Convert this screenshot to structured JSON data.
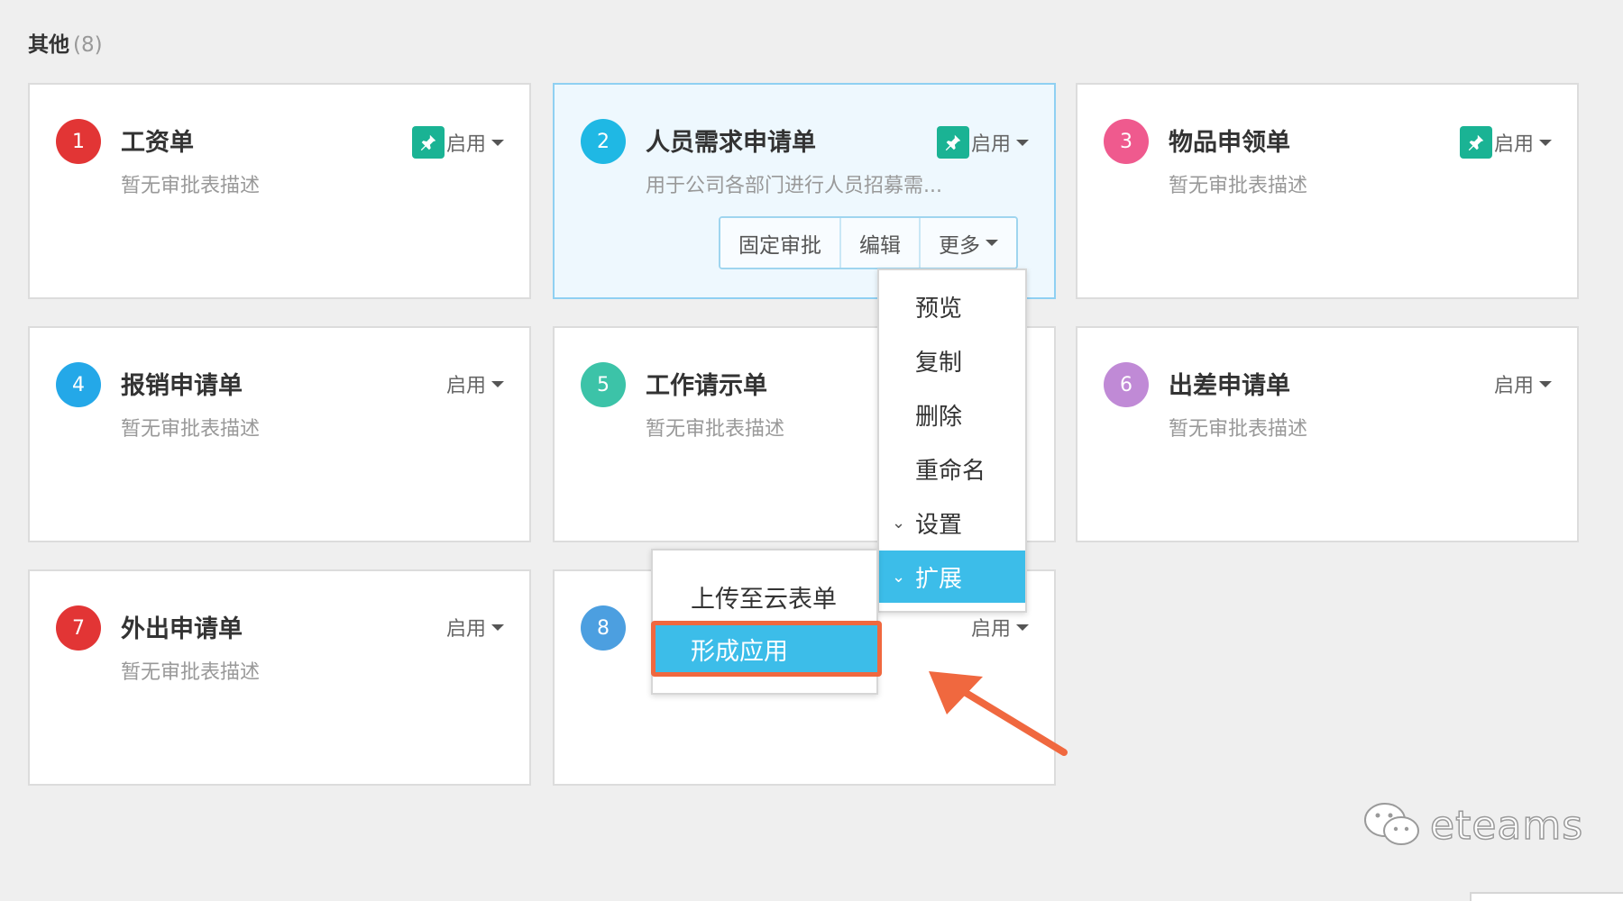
{
  "section": {
    "title": "其他",
    "count": "(8)"
  },
  "cards": [
    {
      "number": "1",
      "title": "工资单",
      "desc": "暂无审批表描述",
      "status": "启用",
      "pinned": true,
      "color": "#e23535"
    },
    {
      "number": "2",
      "title": "人员需求申请单",
      "desc": "用于公司各部门进行人员招募需...",
      "status": "启用",
      "pinned": true,
      "color": "#1fb8e4"
    },
    {
      "number": "3",
      "title": "物品申领单",
      "desc": "暂无审批表描述",
      "status": "启用",
      "pinned": true,
      "color": "#ef5a8e"
    },
    {
      "number": "4",
      "title": "报销申请单",
      "desc": "暂无审批表描述",
      "status": "启用",
      "pinned": false,
      "color": "#24a8e8"
    },
    {
      "number": "5",
      "title": "工作请示单",
      "desc": "暂无审批表描述",
      "status": "",
      "pinned": false,
      "color": "#3cc3a8"
    },
    {
      "number": "6",
      "title": "出差申请单",
      "desc": "暂无审批表描述",
      "status": "启用",
      "pinned": false,
      "color": "#c08ad6"
    },
    {
      "number": "7",
      "title": "外出申请单",
      "desc": "暂无审批表描述",
      "status": "启用",
      "pinned": false,
      "color": "#e23535"
    },
    {
      "number": "8",
      "title": "",
      "desc": "",
      "status": "启用",
      "pinned": false,
      "color": "#4c9fe0"
    }
  ],
  "actions": {
    "fixed": "固定审批",
    "edit": "编辑",
    "more": "更多"
  },
  "more_menu": [
    "预览",
    "复制",
    "删除",
    "重命名",
    "设置",
    "扩展"
  ],
  "submenu": [
    "上传至云表单",
    "形成应用"
  ],
  "watermark": {
    "text": "eteams"
  },
  "colors": {
    "pin": "#1ab394",
    "menu_highlight": "#3cbde9",
    "callout": "#f0683f"
  }
}
